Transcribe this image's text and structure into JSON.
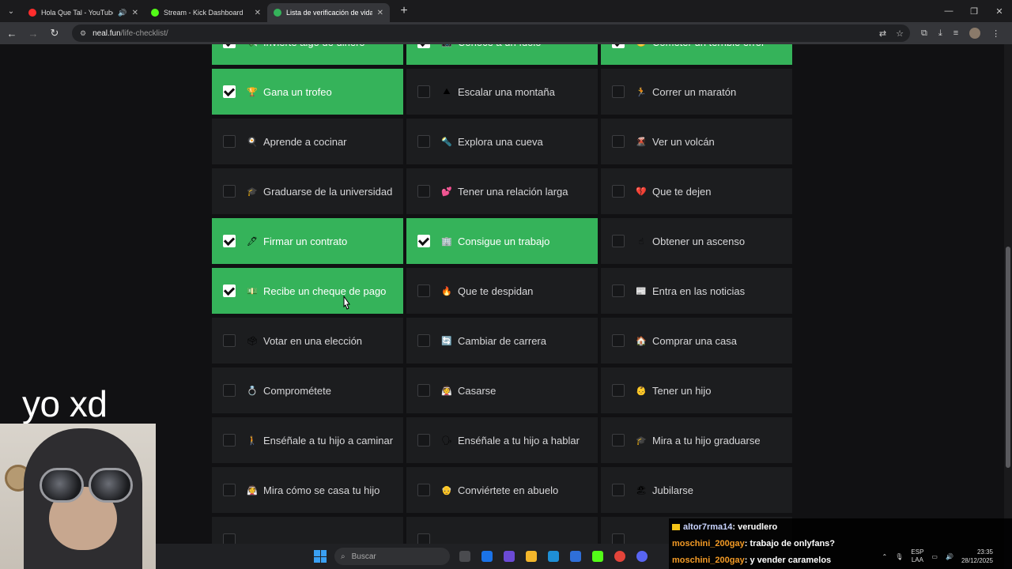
{
  "browser": {
    "tabs": [
      {
        "title": "Hola Que Tal - YouTube Mu",
        "color": "#ff2d2d",
        "audio": true,
        "active": false
      },
      {
        "title": "Stream - Kick Dashboard",
        "color": "#53fc18",
        "audio": false,
        "active": false
      },
      {
        "title": "Lista de verificación de vida",
        "color": "#35b35a",
        "audio": false,
        "active": true
      }
    ],
    "url_host": "neal.fun",
    "url_path": "/life-checklist/"
  },
  "checklist": [
    {
      "label": "Invierte algo de dinero",
      "emoji": "💸",
      "done": true
    },
    {
      "label": "Conoce a un ídolo",
      "emoji": "📸",
      "done": true
    },
    {
      "label": "Cometer un terrible error",
      "emoji": "😬",
      "done": true
    },
    {
      "label": "Gana un trofeo",
      "emoji": "🏆",
      "done": true
    },
    {
      "label": "Escalar una montaña",
      "emoji": "⛰",
      "done": false
    },
    {
      "label": "Correr un maratón",
      "emoji": "🏃",
      "done": false
    },
    {
      "label": "Aprende a cocinar",
      "emoji": "🍳",
      "done": false
    },
    {
      "label": "Explora una cueva",
      "emoji": "🔦",
      "done": false
    },
    {
      "label": "Ver un volcán",
      "emoji": "🌋",
      "done": false
    },
    {
      "label": "Graduarse de la universidad",
      "emoji": "🎓",
      "done": false
    },
    {
      "label": "Tener una relación larga",
      "emoji": "💕",
      "done": false
    },
    {
      "label": "Que te dejen",
      "emoji": "💔",
      "done": false
    },
    {
      "label": "Firmar un contrato",
      "emoji": "🖊",
      "done": true
    },
    {
      "label": "Consigue un trabajo",
      "emoji": "🏢",
      "done": true
    },
    {
      "label": "Obtener un ascenso",
      "emoji": "☝",
      "done": false
    },
    {
      "label": "Recibe un cheque de pago",
      "emoji": "💵",
      "done": true
    },
    {
      "label": "Que te despidan",
      "emoji": "🔥",
      "done": false
    },
    {
      "label": "Entra en las noticias",
      "emoji": "📰",
      "done": false
    },
    {
      "label": "Votar en una elección",
      "emoji": "🗳",
      "done": false
    },
    {
      "label": "Cambiar de carrera",
      "emoji": "🔄",
      "done": false
    },
    {
      "label": "Comprar una casa",
      "emoji": "🏠",
      "done": false
    },
    {
      "label": "Comprométete",
      "emoji": "💍",
      "done": false
    },
    {
      "label": "Casarse",
      "emoji": "👰",
      "done": false
    },
    {
      "label": "Tener un hijo",
      "emoji": "👶",
      "done": false
    },
    {
      "label": "Enséñale a tu hijo a caminar",
      "emoji": "🚶",
      "done": false
    },
    {
      "label": "Enséñale a tu hijo a hablar",
      "emoji": "🗣",
      "done": false
    },
    {
      "label": "Mira a tu hijo graduarse",
      "emoji": "🎓",
      "done": false
    },
    {
      "label": "Mira cómo se casa tu hijo",
      "emoji": "👰",
      "done": false
    },
    {
      "label": "Conviértete en abuelo",
      "emoji": "👴",
      "done": false
    },
    {
      "label": "Jubilarse",
      "emoji": "🏖",
      "done": false
    },
    {
      "label": "",
      "emoji": "",
      "done": false
    },
    {
      "label": "",
      "emoji": "",
      "done": false
    },
    {
      "label": "",
      "emoji": "",
      "done": false
    }
  ],
  "overlay": {
    "caption": "yo xd"
  },
  "chat": [
    {
      "user": "altor7rma14",
      "message": ": verudlero",
      "badge": true
    },
    {
      "user": "moschini_200gay",
      "message": ": trabajo de onlyfans?",
      "badge": false
    },
    {
      "user": "moschini_200gay",
      "message": ": y vender caramelos",
      "badge": false
    }
  ],
  "taskbar": {
    "search_placeholder": "Buscar",
    "lang_top": "ESP",
    "lang_bottom": "LAA",
    "time": "23:35",
    "date": "28/12/2025"
  }
}
